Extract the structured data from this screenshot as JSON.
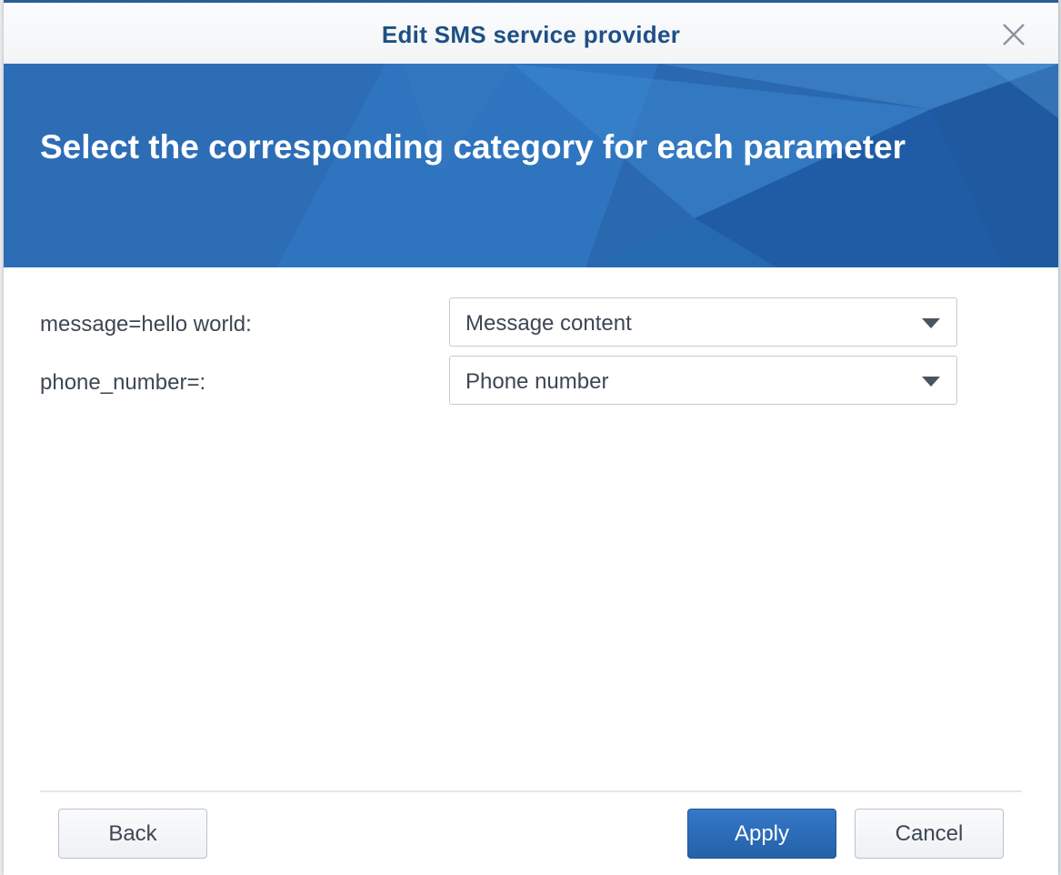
{
  "dialog": {
    "title": "Edit SMS service provider",
    "close_icon": "close-icon"
  },
  "banner": {
    "title": "Select the corresponding category for each parameter"
  },
  "parameters": [
    {
      "label": "message=hello world:",
      "selected": "Message content"
    },
    {
      "label": "phone_number=:",
      "selected": "Phone number"
    }
  ],
  "buttons": {
    "back": "Back",
    "apply": "Apply",
    "cancel": "Cancel"
  },
  "colors": {
    "accent": "#2461a8",
    "title": "#1f4f85",
    "banner": "#2a68b0"
  }
}
